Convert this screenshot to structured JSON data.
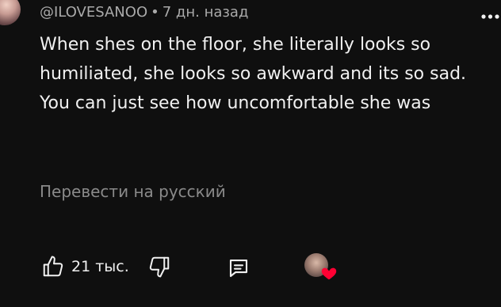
{
  "comment": {
    "author": "@ILOVESANOO",
    "separator": "•",
    "timestamp": "7 дн. назад",
    "text": "When shes on the floor, she literally looks so humiliated, she looks so awkward and its so sad. You can just see how uncomfortable she was",
    "translate_label": "Перевести на русский",
    "like_count": "21 тыс."
  },
  "icons": {
    "more": "more-vertical-icon",
    "like": "thumb-up-icon",
    "dislike": "thumb-down-icon",
    "reply": "comment-icon",
    "creator_heart": "heart-icon"
  },
  "colors": {
    "background": "#0f0f0f",
    "text": "#f1f1f1",
    "secondary_text": "#aaaaaa",
    "heart": "#ff0033"
  }
}
